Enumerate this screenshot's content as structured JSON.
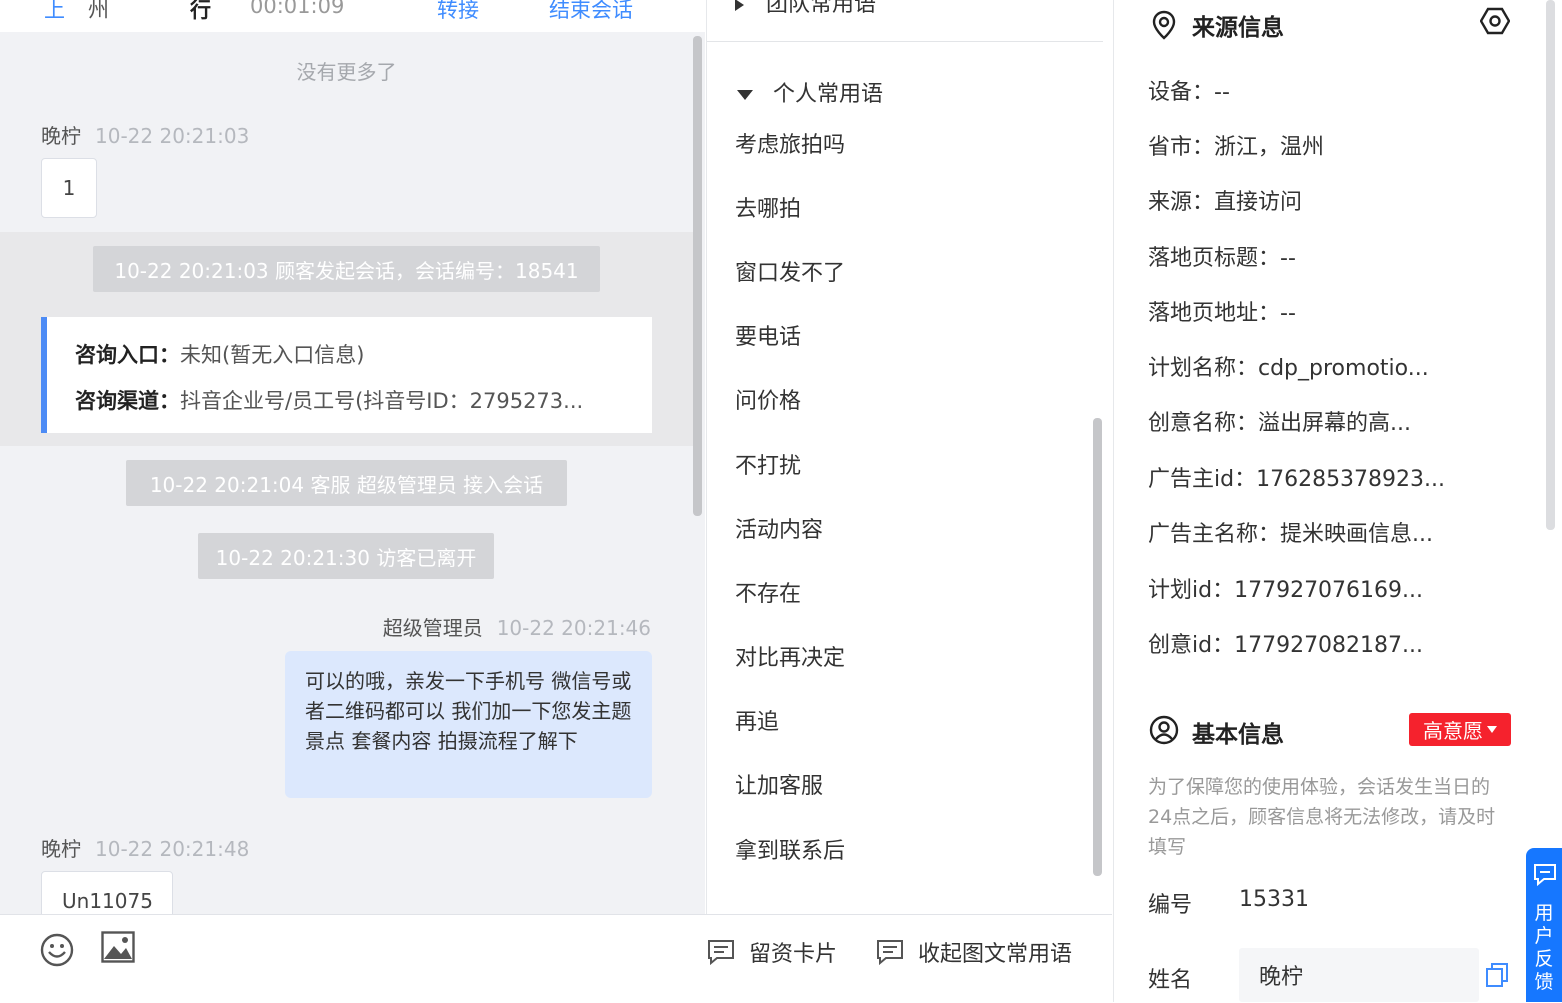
{
  "chat": {
    "top": {
      "c1": "上",
      "c2": "州",
      "c3": "行",
      "duration": "00:01:09",
      "transfer": "转接",
      "end": "结束会话"
    },
    "no_more": "没有更多了",
    "messages": [
      {
        "name": "晚柠",
        "time": "10-22 20:21:03",
        "text": "1"
      },
      {
        "name": "晚柠",
        "time": "10-22 20:21:48",
        "text": "Un11075"
      }
    ],
    "system": [
      "10-22 20:21:03 顾客发起会话，会话编号：18541",
      "10-22 20:21:04 客服 超级管理员 接入会话",
      "10-22 20:21:30 访客已离开"
    ],
    "card": {
      "entry_label": "咨询入口：",
      "entry_value": "未知(暂无入口信息)",
      "channel_label": "咨询渠道：",
      "channel_value": "抖音企业号/员工号(抖音号ID：2795273..."
    },
    "agent": {
      "name": "超级管理员",
      "time": "10-22 20:21:46",
      "text": "可以的哦，亲发一下手机号 微信号或者二维码都可以 我们加一下您发主题景点 套餐内容 拍摄流程了解下"
    }
  },
  "composer": {
    "lead_card": "留资卡片",
    "collapse": "收起图文常用语"
  },
  "phrases": {
    "team_header": "团队常用语",
    "personal_header": "个人常用语",
    "items": [
      "考虑旅拍吗",
      "去哪拍",
      "窗口发不了",
      "要电话",
      "问价格",
      "不打扰",
      "活动内容",
      "不存在",
      "对比再决定",
      "再追",
      "让加客服",
      "拿到联系后"
    ]
  },
  "info": {
    "source_title": "来源信息",
    "source_rows": [
      "设备：--",
      "省市：浙江，温州",
      "来源：直接访问",
      "落地页标题：--",
      "落地页地址：--",
      "计划名称：cdp_promotio...",
      "创意名称：溢出屏幕的高...",
      "广告主id：176285378923...",
      "广告主名称：提米映画信息...",
      "计划id：177927076169...",
      "创意id：177927082187..."
    ],
    "basic_title": "基本信息",
    "intent_badge": "高意愿",
    "notice": "为了保障您的使用体验，会话发生当日的24点之后，顾客信息将无法修改，请及时填写",
    "id_label": "编号",
    "id_value": "15331",
    "name_label": "姓名",
    "name_value": "晚柠"
  },
  "feedback": {
    "label": "用户反馈"
  },
  "colors": {
    "accent": "#3f8cff",
    "card_border": "#4d8bf5",
    "agent_bubble": "#dce8fd",
    "badge": "#f5222d"
  }
}
